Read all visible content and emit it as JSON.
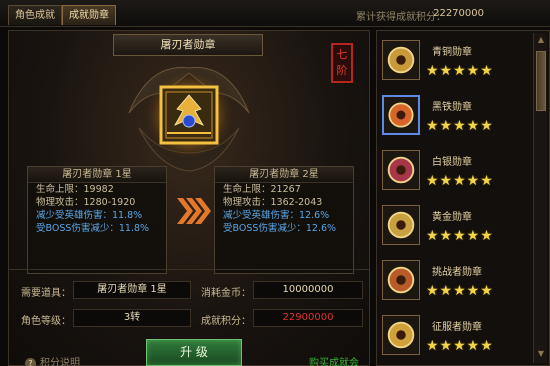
{
  "tabs": [
    {
      "label": "角色成就"
    },
    {
      "label": "成就勋章"
    }
  ],
  "total": {
    "label": "累计获得成就积分：",
    "value": "22270000"
  },
  "medal_title": "屠刃者勋章",
  "rank_seal": "七阶",
  "current": {
    "header": "屠刃者勋章 1星",
    "hp_label": "生命上限：",
    "hp_value": "19982",
    "atk_label": "物理攻击：",
    "atk_value": "1280-1920",
    "hero_label": "减少受英雄伤害：",
    "hero_value": "11.8%",
    "boss_label": "受BOSS伤害减少：",
    "boss_value": "11.8%"
  },
  "next": {
    "header": "屠刃者勋章 2星",
    "hp_label": "生命上限：",
    "hp_value": "21267",
    "atk_label": "物理攻击：",
    "atk_value": "1362-2043",
    "hero_label": "减少受英雄伤害：",
    "hero_value": "12.6%",
    "boss_label": "受BOSS伤害减少：",
    "boss_value": "12.6%"
  },
  "form": {
    "item_label": "需要道具：",
    "item_value": "屠刃者勋章 1星",
    "gold_label": "消耗金币：",
    "gold_value": "10000000",
    "level_label": "角色等级：",
    "level_value": "3转",
    "points_label": "成就积分：",
    "points_value": "22900000"
  },
  "upgrade_label": "升 级",
  "help_label": "积分说明",
  "buy_label": "购买成就会>>",
  "medals": [
    {
      "name": "青铜勋章",
      "stars": 5,
      "active": false
    },
    {
      "name": "黑铁勋章",
      "stars": 5,
      "active": true
    },
    {
      "name": "白银勋章",
      "stars": 5,
      "active": false
    },
    {
      "name": "黄金勋章",
      "stars": 5,
      "active": false
    },
    {
      "name": "挑战者勋章",
      "stars": 5,
      "active": false
    },
    {
      "name": "征服者勋章",
      "stars": 5,
      "active": false
    }
  ],
  "colors": {
    "gold": "#f1d44a",
    "red": "#e0342a",
    "blue": "#5aa6e8",
    "green": "#3bb33b"
  }
}
